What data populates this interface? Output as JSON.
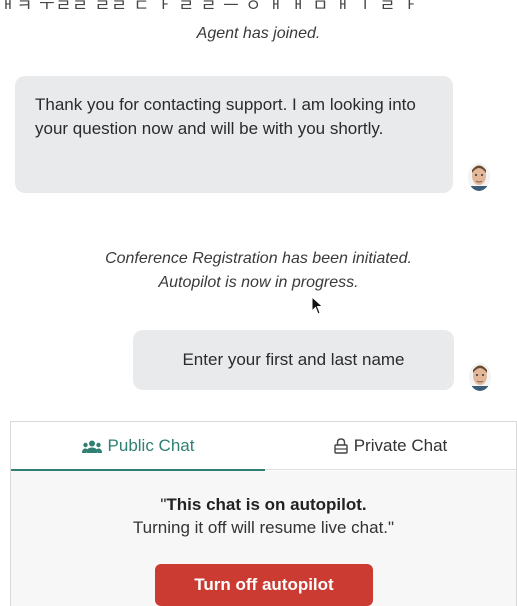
{
  "header_clip": "ㅐㅋ ㅜㄹㄹ ㄹㄹ ㄷ ㅏ ㄹ ㄹ ㅡ ㅇ ㅐ ㅐ ㅁ ㅐ ㅣ ㄹ ㅏ",
  "chat": {
    "system_joined": "Agent has joined.",
    "agent_message": "Thank you for contacting support. I am looking into your question now and will be with you shortly.",
    "system_autopilot_line1": "Conference Registration has been initiated.",
    "system_autopilot_line2": "Autopilot is now in progress.",
    "bot_message": "Enter your first and last name"
  },
  "tabs": {
    "public": "Public Chat",
    "private": "Private Chat"
  },
  "autopilot": {
    "open_quote": "\"",
    "title": "This chat is on autopilot.",
    "subtitle": "Turning it off will resume live chat.\"",
    "button_label": "Turn off autopilot"
  },
  "colors": {
    "accent": "#2f7f73",
    "button": "#cc3b32",
    "bubble": "#e9eaec"
  },
  "icons": {
    "public_tab": "users-icon",
    "private_tab": "lock-icon",
    "avatar": "agent-avatar",
    "cursor": "mouse-pointer"
  }
}
